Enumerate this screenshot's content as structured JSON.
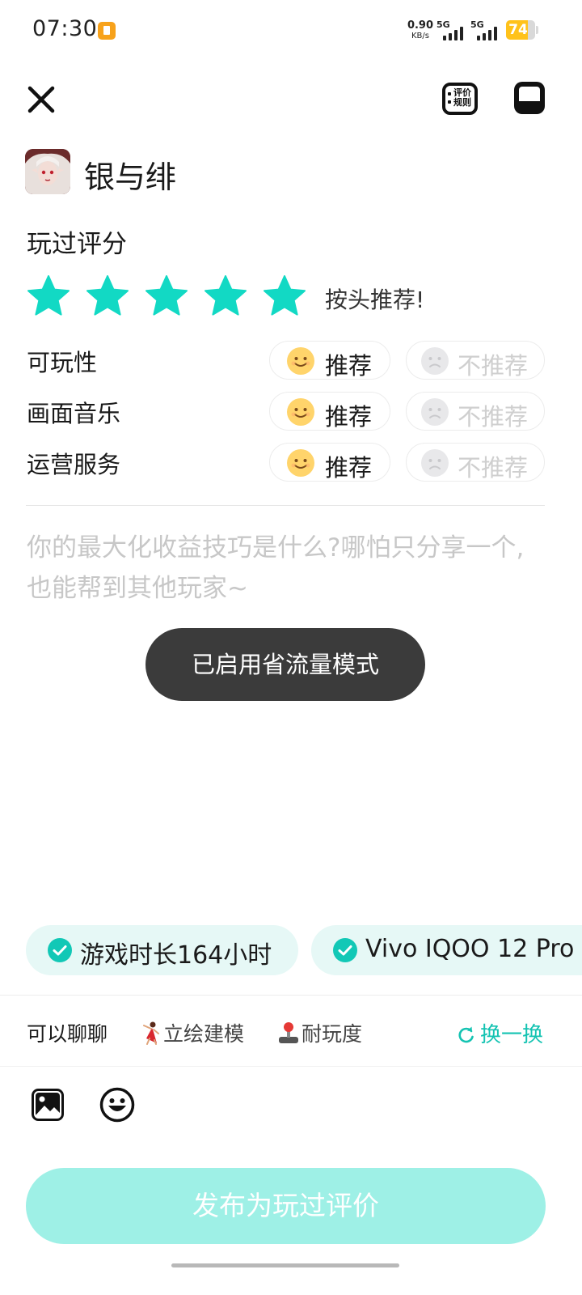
{
  "status_bar": {
    "time": "07:30",
    "net_speed_value": "0.90",
    "net_speed_unit": "KB/s",
    "signal_1_label": "5G",
    "signal_2_label": "5G",
    "battery_level": "74"
  },
  "header": {
    "rules_label": "评价规则"
  },
  "game": {
    "title": "银与绯"
  },
  "rating": {
    "section_title": "玩过评分",
    "stars_filled": 5,
    "stars_total": 5,
    "star_color": "#12d9c4",
    "caption": "按头推荐!"
  },
  "aspects": [
    {
      "label": "可玩性",
      "recommend_label": "推荐",
      "not_recommend_label": "不推荐",
      "selected": "recommend"
    },
    {
      "label": "画面音乐",
      "recommend_label": "推荐",
      "not_recommend_label": "不推荐",
      "selected": "recommend"
    },
    {
      "label": "运营服务",
      "recommend_label": "推荐",
      "not_recommend_label": "不推荐",
      "selected": "recommend"
    }
  ],
  "review": {
    "placeholder": "你的最大化收益技巧是什么?哪怕只分享一个,也能帮到其他玩家~"
  },
  "toast": {
    "text": "已启用省流量模式"
  },
  "chips": [
    {
      "label": "游戏时长164小时"
    },
    {
      "label": "Vivo IQOO 12 Pro"
    }
  ],
  "topics": {
    "label": "可以聊聊",
    "items": [
      {
        "label": "立绘建模",
        "icon": "dancer-emoji-icon"
      },
      {
        "label": "耐玩度",
        "icon": "joystick-emoji-icon"
      }
    ],
    "refresh_label": "换一换"
  },
  "toolbar": {
    "image_icon": "image-icon",
    "emoji_icon": "emoji-icon"
  },
  "publish": {
    "label": "发布为玩过评价",
    "color": "#9ef0e6"
  }
}
